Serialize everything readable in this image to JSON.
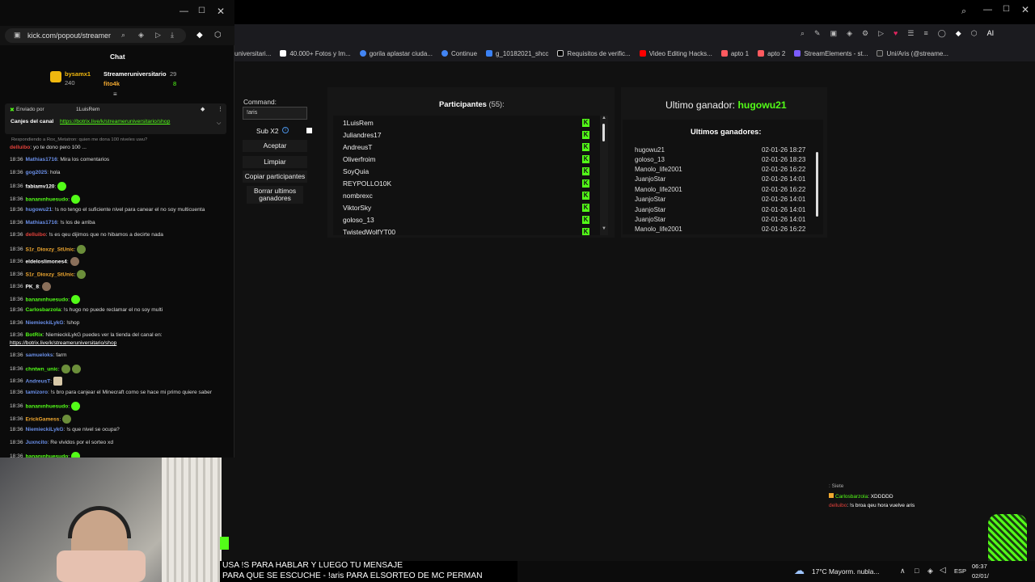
{
  "popout": {
    "url": "kick.com/popout/streamer",
    "chat_title": "Chat",
    "top_gifters": [
      {
        "name": "bysamx1",
        "count": "240"
      },
      {
        "name": "Streameruniversitario",
        "count": "29"
      },
      {
        "name": "fito4k",
        "count": "8"
      }
    ],
    "pinned": {
      "sent_by_label": "Enviado por",
      "sent_by_user": "1LuisRem",
      "message": "Canjes del canal",
      "link": "https://botrix.live/k/streameruniversitario/shop"
    },
    "reply_to": "Respondiendo a Rox_Metatron: quien me dona 100 niveles uwu?",
    "messages": [
      {
        "time": "",
        "user": "delluibo",
        "user_color": "#e2413b",
        "text": ": yo te dono pero 100 ..."
      },
      {
        "time": "18:36",
        "user": "Mathias1716",
        "user_color": "#6a8fe8",
        "text": ": Mira los comentarios"
      },
      {
        "time": "18:36",
        "user": "gog2025",
        "user_color": "#6a8fe8",
        "text": ": hola"
      },
      {
        "time": "18:36",
        "user": "fabiamv120",
        "user_color": "#fff",
        "text": ":"
      },
      {
        "time": "18:36",
        "user": "bananınhuesudo",
        "user_color": "#53fc18",
        "text": ":"
      },
      {
        "time": "18:36",
        "user": "hugowu21",
        "user_color": "#6a8fe8",
        "text": ": !s no tengo el suficiente nivel para canear el no soy multicuenta"
      },
      {
        "time": "18:36",
        "user": "Mathias1716",
        "user_color": "#6a8fe8",
        "text": ": !s los de arriba"
      },
      {
        "time": "18:36",
        "user": "delluibo",
        "user_color": "#e2413b",
        "text": ": !s es qeu dijimos que no hibamos a decirte nada"
      },
      {
        "time": "18:36",
        "user": "S1r_Dioxzy_StUnic",
        "user_color": "#f0a830",
        "text": ":"
      },
      {
        "time": "18:36",
        "user": "eldeloslimones4",
        "user_color": "#fff",
        "text": ":"
      },
      {
        "time": "18:36",
        "user": "S1r_Dioxzy_StUnic",
        "user_color": "#f0a830",
        "text": ":"
      },
      {
        "time": "18:36",
        "user": "PK_8",
        "user_color": "#fff",
        "text": ":"
      },
      {
        "time": "18:36",
        "user": "bananınhuesudo",
        "user_color": "#53fc18",
        "text": ":"
      },
      {
        "time": "18:36",
        "user": "Carlosbarzola",
        "user_color": "#53fc18",
        "text": ": !s hugo no puede reclamar el no soy multi"
      },
      {
        "time": "18:36",
        "user": "NiemieckiLykG",
        "user_color": "#6a8fe8",
        "text": ": !shop"
      },
      {
        "time": "18:36",
        "user": "BotRix",
        "user_color": "#53fc18",
        "text": ": NiemieckiLykG puedes ver la tienda del canal en:"
      },
      {
        "time": "",
        "user": "",
        "user_color": "#fff",
        "text": "https://botrix.live/k/streameruniversitario/shop"
      },
      {
        "time": "18:36",
        "user": "samueloks",
        "user_color": "#6a8fe8",
        "text": ": farm"
      },
      {
        "time": "18:36",
        "user": "chntwn_unic",
        "user_color": "#53fc18",
        "text": ":"
      },
      {
        "time": "18:36",
        "user": "AndreusT",
        "user_color": "#6a8fe8",
        "text": ":"
      },
      {
        "time": "18:36",
        "user": "tamizoro",
        "user_color": "#6a8fe8",
        "text": ": !s bro para canjear el Minecraft como se hace mi primo quiere saber"
      },
      {
        "time": "18:36",
        "user": "bananınhuesudo",
        "user_color": "#53fc18",
        "text": ":"
      },
      {
        "time": "18:36",
        "user": "ErickGamess",
        "user_color": "#f0a830",
        "text": ":"
      },
      {
        "time": "18:36",
        "user": "NiemieckiLykG",
        "user_color": "#6a8fe8",
        "text": ": !s que nivel se ocupa?"
      },
      {
        "time": "18:36",
        "user": "Juxncito",
        "user_color": "#6a8fe8",
        "text": ": Re vividos por el sorteo xd"
      },
      {
        "time": "18:36",
        "user": "bananınhuesudo",
        "user_color": "#53fc18",
        "text": ":"
      }
    ]
  },
  "bookmarks": [
    "universitari...",
    "40.000+ Fotos y Im...",
    "gorila aplastar ciuda...",
    "Continue",
    "g_10182021_shcc",
    "Requisitos de verific...",
    "Video Editing Hacks...",
    "apto 1",
    "apto 2",
    "StreamElements - st...",
    "Uni/Aris (@streame..."
  ],
  "app": {
    "command_label": "Command:",
    "command_value": "!aris",
    "sub_label": "Sub X2",
    "buttons": [
      "Aceptar",
      "Limpiar",
      "Copiar participantes",
      "Borrar ultimos ganadores"
    ],
    "participants_label": "Participantes",
    "participants_count": "(55):",
    "participants": [
      "1LuisRem",
      "Juliandres17",
      "AndreusT",
      "Oliverfroim",
      "SoyQuia",
      "REYPOLLO10K",
      "nombrexc",
      "ViktorSky",
      "goloso_13",
      "TwistedWolfYT00"
    ],
    "last_winner_label": "Ultimo ganador:",
    "last_winner": "hugowu21",
    "winners_title": "Ultimos ganadores:",
    "winners": [
      {
        "name": "hugowu21",
        "date": "02-01-26 18:27"
      },
      {
        "name": "goloso_13",
        "date": "02-01-26 18:23"
      },
      {
        "name": "Manolo_life2001",
        "date": "02-01-26 16:22"
      },
      {
        "name": "JuanjoStar",
        "date": "02-01-26 14:01"
      },
      {
        "name": "Manolo_life2001",
        "date": "02-01-26 16:22"
      },
      {
        "name": "JuanjoStar",
        "date": "02-01-26 14:01"
      },
      {
        "name": "JuanjoStar",
        "date": "02-01-26 14:01"
      },
      {
        "name": "JuanjoStar",
        "date": "02-01-26 14:01"
      },
      {
        "name": "Manolo_life2001",
        "date": "02-01-26 16:22"
      }
    ]
  },
  "overlay_chat": [
    {
      "user": "",
      "text": ": Siete"
    },
    {
      "user": "Carlosbarzola",
      "text": ": XDDDDD"
    },
    {
      "user": "delluibo",
      "text": ": !s broa qeu hora vuelve aris"
    }
  ],
  "overlay_text": {
    "line1": "USA !S PARA HABLAR Y LUEGO TU MENSAJE",
    "line2": "PARA QUE SE ESCUCHE - !aris PARA ELSORTEO DE MC PERMAN"
  },
  "taskbar": {
    "weather": "17°C Mayorm. nubla...",
    "lang": "ESP",
    "time": "06:37",
    "date": "02/01/"
  },
  "colors": {
    "kick_green": "#53fc18",
    "winner_green": "#53fc18"
  }
}
